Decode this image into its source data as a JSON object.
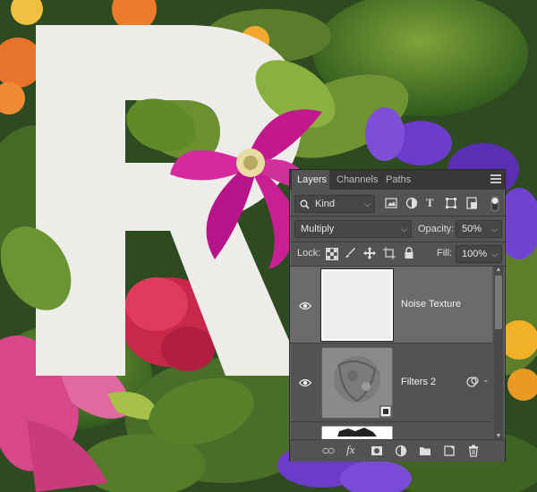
{
  "panel": {
    "tabs": [
      "Layers",
      "Channels",
      "Paths"
    ],
    "active_tab": "Layers",
    "filter": {
      "value": "Kind"
    },
    "blend_mode": {
      "value": "Multiply"
    },
    "opacity": {
      "label": "Opacity:",
      "value": "50%"
    },
    "lock": {
      "label": "Lock:"
    },
    "fill": {
      "label": "Fill:",
      "value": "100%"
    },
    "layers": [
      {
        "name": "Noise Texture",
        "visible": true,
        "selected": true
      },
      {
        "name": "Filters 2",
        "visible": true,
        "selected": false,
        "smart_filter": true
      },
      {
        "name": "",
        "visible": true,
        "selected": false
      }
    ],
    "footer_icons": [
      "link-icon",
      "fx-icon",
      "mask-icon",
      "adjustment-icon",
      "group-folder-icon",
      "new-layer-icon",
      "trash-icon"
    ]
  },
  "colors": {
    "panel_bg": "#535353",
    "tab_bar_bg": "#383838",
    "selected_layer_bg": "#6b6b6b",
    "letter_fill": "#f0efec"
  },
  "artwork": {
    "letter": "R"
  }
}
